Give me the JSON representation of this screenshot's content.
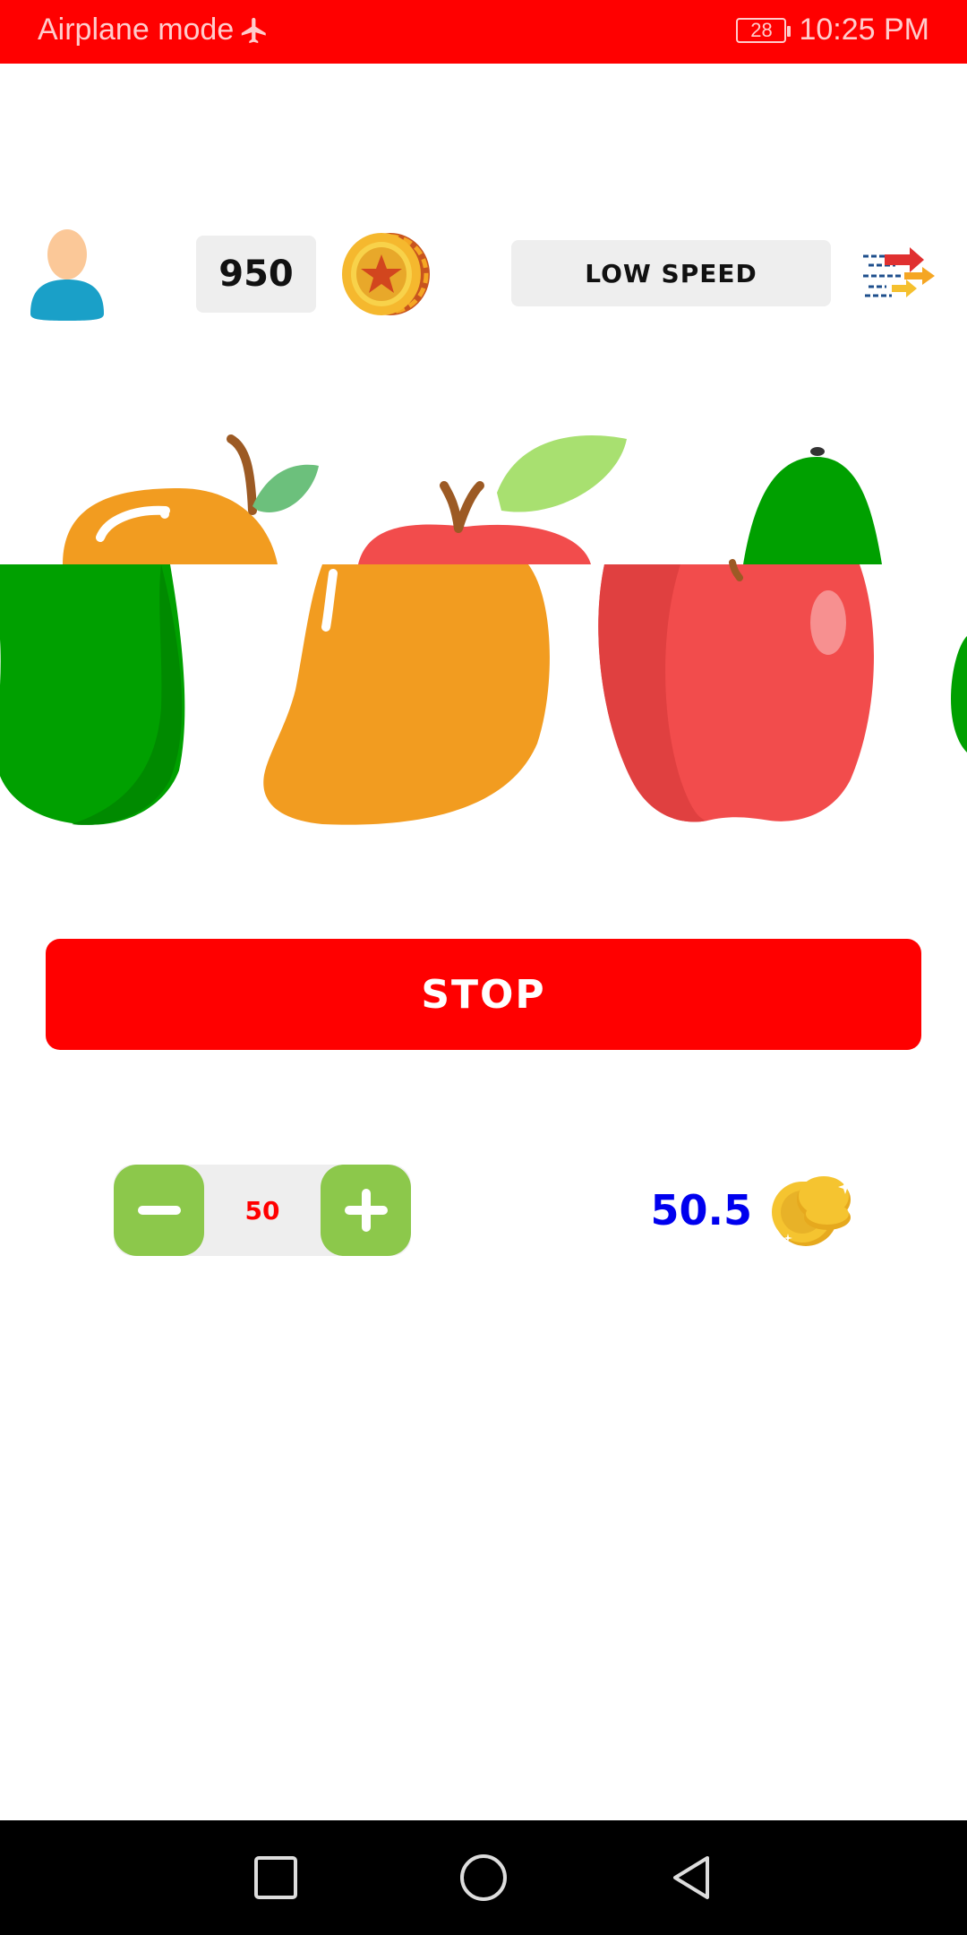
{
  "status_bar": {
    "left_text": "Airplane mode",
    "battery_level": "28",
    "time": "10:25 PM"
  },
  "header": {
    "balance": "950",
    "speed_label": "LOW SPEED"
  },
  "reels": {
    "row1": [
      "mango",
      "apple",
      "avocado"
    ],
    "row2": [
      "avocado",
      "mango",
      "apple",
      "avocado"
    ]
  },
  "controls": {
    "stop_label": "STOP",
    "bet_value": "50",
    "win_value": "50.5"
  },
  "icons": {
    "avatar": "user-avatar-icon",
    "coin": "star-coin-icon",
    "speed": "speed-arrows-icon",
    "coins": "coin-stack-icon",
    "minus": "minus-icon",
    "plus": "plus-icon"
  },
  "colors": {
    "status_bar": "#ff0000",
    "stop_button": "#ff0000",
    "stepper_button": "#8cc84b",
    "bet_text": "#ff0000",
    "win_text": "#0000ee"
  }
}
